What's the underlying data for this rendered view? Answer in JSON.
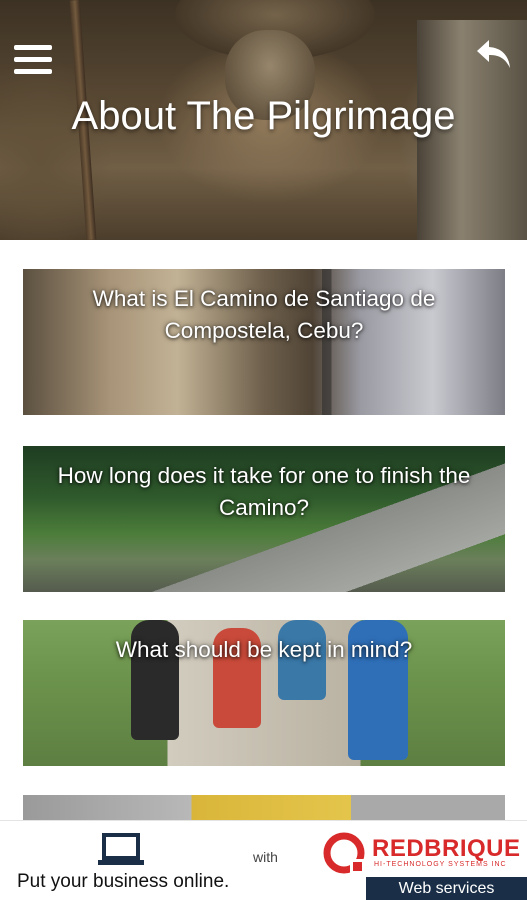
{
  "header": {
    "title": "About The Pilgrimage",
    "menu_icon": "hamburger-menu-icon",
    "back_icon": "back-arrow-icon"
  },
  "cards": [
    {
      "title": "What is El Camino de Santiago de Compostela, Cebu?"
    },
    {
      "title": "How long does it take for one to finish the Camino?"
    },
    {
      "title": "What should be kept in mind?"
    },
    {
      "title": ""
    }
  ],
  "ad": {
    "tagline": "Put your business online.",
    "connector": "with",
    "brand": "REDBRIQUE",
    "brand_sub": "HI-TECHNOLOGY SYSTEMS INC",
    "service": "Web services",
    "brand_color": "#d82a2a",
    "service_bg": "#1a2f47"
  }
}
